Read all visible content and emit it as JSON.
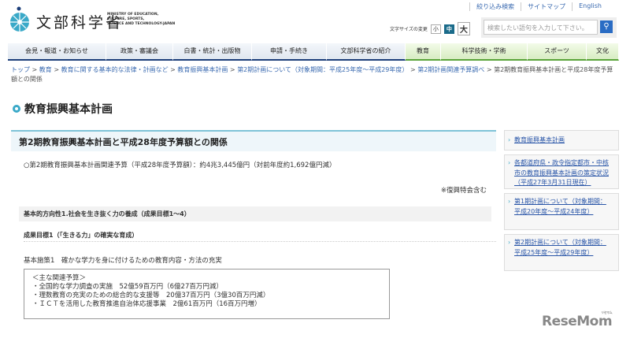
{
  "header": {
    "logo_ja": "文部科学省",
    "logo_en": "MINISTRY OF EDUCATION,\nCULTURE, SPORTS,\nSCIENCE AND TECHNOLOGY-JAPAN",
    "top_links": [
      "絞り込み検索",
      "サイトマップ",
      "English"
    ],
    "font_size_label": "文字サイズの変更",
    "font_sizes": [
      "小",
      "中",
      "大"
    ],
    "search_placeholder": "検索したい語句を入力して下さい。"
  },
  "nav": [
    "会見・報道・お知らせ",
    "政策・審議会",
    "白書・統計・出版物",
    "申請・手続き",
    "文部科学省の紹介",
    "教育",
    "科学技術・学術",
    "スポーツ",
    "文化"
  ],
  "breadcrumb": [
    "トップ",
    "教育",
    "教育に関する基本的な法律・計画など",
    "教育振興基本計画",
    "第2期計画について（対象期間：平成25年度～平成29年度）",
    "第2期計画関連予算調べ"
  ],
  "breadcrumb_current": "第2期教育振興基本計画と平成28年度予算額との関係",
  "page_title": "教育振興基本計画",
  "main": {
    "heading": "第2期教育振興基本計画と平成28年度予算額との関係",
    "summary": "○第2期教育振興基本計画関連予算（平成28年度予算額）：約4兆3,445億円（対前年度約1,692億円減）",
    "note": "※復興特会含む",
    "section": "基本的方向性1.社会を生き抜く力の養成（成果目標1～4）",
    "goal": "成果目標1（「生きる力」の確実な育成）",
    "policy": "基本施策1　確かな学力を身に付けるための教育内容・方法の充実",
    "budget_title": "＜主な関連予算＞",
    "budget_items": [
      "・全国的な学力調査の実施　52億59百万円（6億27百万円減）",
      "・理数教育の充実のための総合的な支援等　20億37百万円（3億30百万円減）",
      "・ＩＣＴを活用した教育推進自治体応援事業　2億61百万円（16百万円増）"
    ]
  },
  "sidebar": [
    "教育振興基本計画",
    "各都道府県・政令指定都市・中核市の教育振興基本計画の策定状況（平成27年3月31日現在）",
    "第1期計画について（対象期間：平成20年度～平成24年度）",
    "第2期計画について（対象期間：平成25年度～平成29年度）"
  ],
  "watermark": "ReseMom",
  "watermark_kana": "リセマム"
}
